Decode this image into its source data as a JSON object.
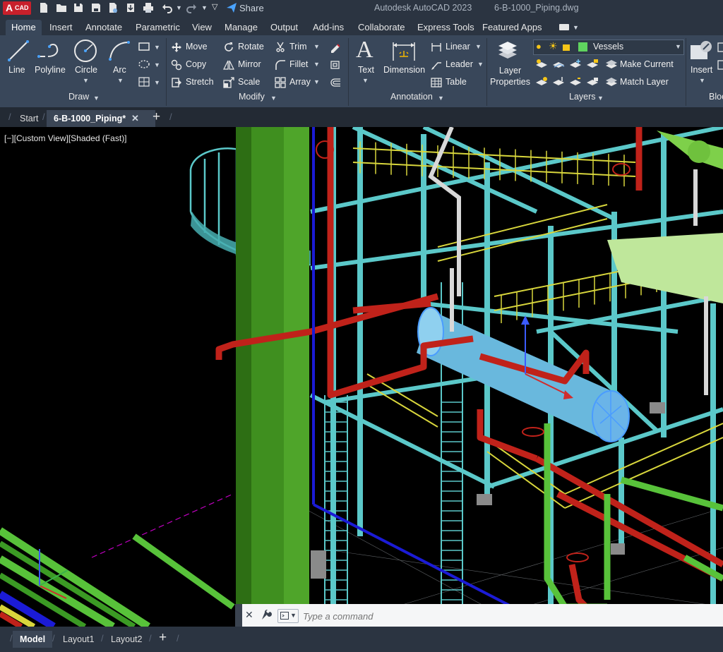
{
  "app": {
    "logo_text": "CAD",
    "title": "Autodesk AutoCAD 2023",
    "file_name": "6-B-1000_Piping.dwg"
  },
  "quick_access": {
    "share_label": "Share"
  },
  "menu_tabs": [
    "Home",
    "Insert",
    "Annotate",
    "Parametric",
    "View",
    "Manage",
    "Output",
    "Add-ins",
    "Collaborate",
    "Express Tools",
    "Featured Apps"
  ],
  "ribbon": {
    "draw": {
      "title": "Draw",
      "line": "Line",
      "polyline": "Polyline",
      "circle": "Circle",
      "arc": "Arc"
    },
    "modify": {
      "title": "Modify",
      "move": "Move",
      "rotate": "Rotate",
      "trim": "Trim",
      "copy": "Copy",
      "mirror": "Mirror",
      "fillet": "Fillet",
      "stretch": "Stretch",
      "scale": "Scale",
      "array": "Array"
    },
    "annotation": {
      "title": "Annotation",
      "text": "Text",
      "dimension": "Dimension",
      "linear": "Linear",
      "leader": "Leader",
      "table": "Table"
    },
    "layers": {
      "title": "Layers",
      "layer_properties_1": "Layer",
      "layer_properties_2": "Properties",
      "current_layer": "Vessels",
      "make_current": "Make Current",
      "match_layer": "Match Layer"
    },
    "block": {
      "title": "Bloc",
      "insert": "Insert"
    }
  },
  "doc_tabs": {
    "start": "Start",
    "active": "6-B-1000_Piping*"
  },
  "viewport": {
    "label": "[−][Custom View][Shaded (Fast)]"
  },
  "command_line": {
    "placeholder": "Type a command"
  },
  "layout_tabs": [
    "Model",
    "Layout1",
    "Layout2"
  ],
  "colors": {
    "titlebar": "#2b3441",
    "ribbon": "#39475a",
    "steel": "#5bc8c9",
    "vessel_green": "#3f8f1f",
    "pipe_red": "#c0221a",
    "pipe_blue": "#1b1bd6",
    "handrail_yellow": "#d8d63c"
  }
}
